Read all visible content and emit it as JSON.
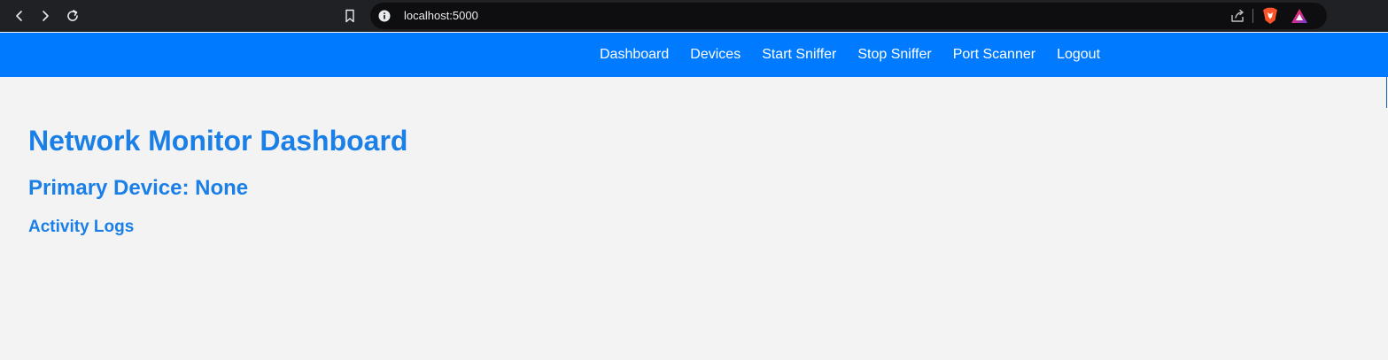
{
  "browser": {
    "url": "localhost:5000",
    "icons": {
      "back": "chevron-left-icon",
      "forward": "chevron-right-icon",
      "reload": "reload-icon",
      "bookmark": "bookmark-icon",
      "site_info": "info-icon",
      "share": "share-icon",
      "brave": "brave-shield-icon",
      "rewards": "brave-rewards-icon"
    }
  },
  "navbar": {
    "background": "#007bff",
    "links": [
      {
        "label": "Dashboard"
      },
      {
        "label": "Devices"
      },
      {
        "label": "Start Sniffer"
      },
      {
        "label": "Stop Sniffer"
      },
      {
        "label": "Port Scanner"
      },
      {
        "label": "Logout"
      }
    ]
  },
  "main": {
    "title": "Network Monitor Dashboard",
    "primary_device": "Primary Device: None",
    "activity_logs_heading": "Activity Logs",
    "heading_color": "#1a7fe6",
    "background": "#f3f3f3"
  }
}
